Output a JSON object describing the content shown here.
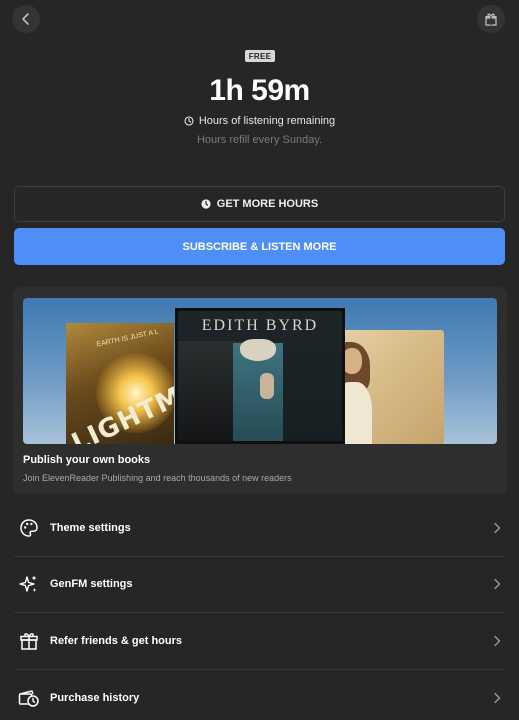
{
  "header": {
    "back_icon": "chevron-left-icon",
    "gift_icon": "gift-icon"
  },
  "plan": {
    "badge": "FREE",
    "hours_remaining": "1h 59m",
    "hours_caption": "Hours of listening remaining",
    "refill_note": "Hours refill every Sunday."
  },
  "actions": {
    "get_more_label": "GET MORE HOURS",
    "subscribe_label": "SUBSCRIBE & LISTEN MORE",
    "accent_color": "#4d8ff7"
  },
  "promo": {
    "title": "Publish your own books",
    "subtitle": "Join ElevenReader Publishing and reach thousands of new readers",
    "books": [
      {
        "cover_text_small": "EARTH IS JUST A L",
        "cover_text_big": "LIGHTM"
      },
      {
        "cover_text": "EDITH BYRD"
      }
    ]
  },
  "menu": {
    "items": [
      {
        "label": "Theme settings",
        "icon": "palette-icon"
      },
      {
        "label": "GenFM settings",
        "icon": "sparkles-icon"
      },
      {
        "label": "Refer friends & get hours",
        "icon": "gift-icon"
      },
      {
        "label": "Purchase history",
        "icon": "purchase-history-icon"
      }
    ]
  }
}
